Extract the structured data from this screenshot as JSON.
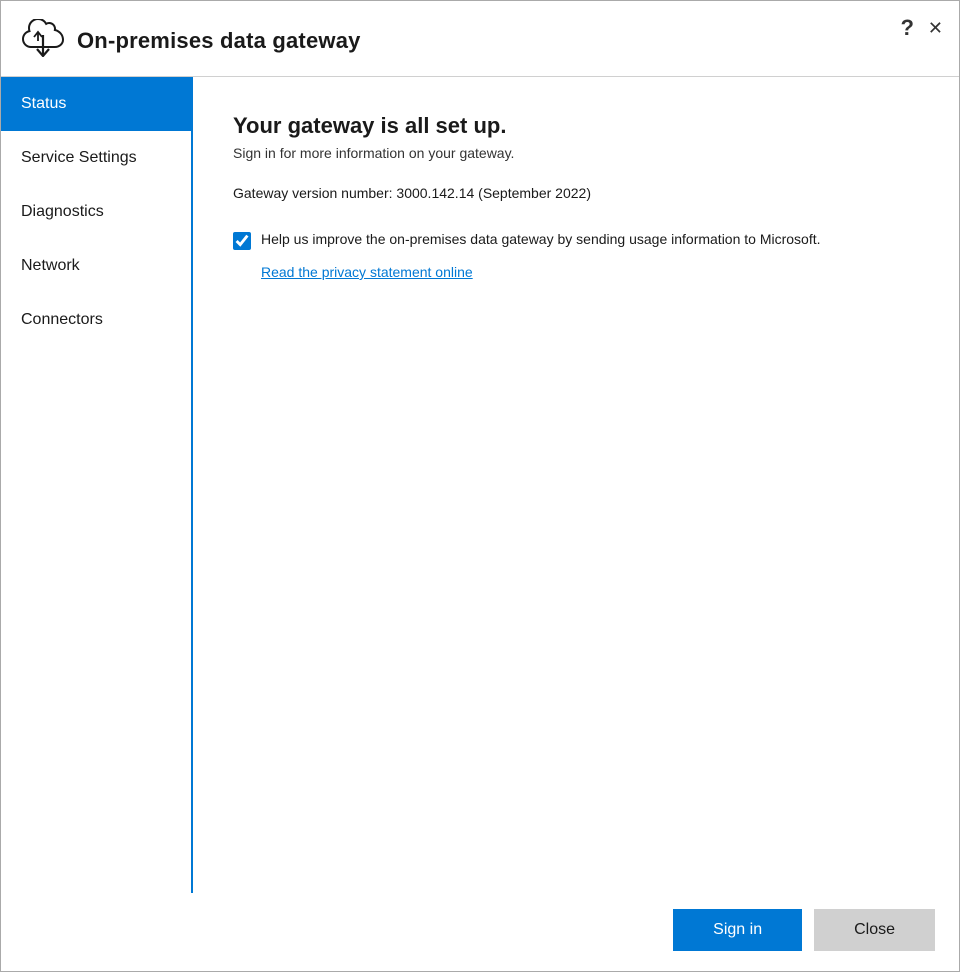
{
  "window": {
    "title": "On-premises data gateway",
    "help_icon": "?",
    "close_icon": "✕"
  },
  "sidebar": {
    "items": [
      {
        "id": "status",
        "label": "Status",
        "active": true
      },
      {
        "id": "service-settings",
        "label": "Service Settings",
        "active": false
      },
      {
        "id": "diagnostics",
        "label": "Diagnostics",
        "active": false
      },
      {
        "id": "network",
        "label": "Network",
        "active": false
      },
      {
        "id": "connectors",
        "label": "Connectors",
        "active": false
      }
    ]
  },
  "content": {
    "title": "Your gateway is all set up.",
    "subtitle": "Sign in for more information on your gateway.",
    "version_text": "Gateway version number: 3000.142.14 (September 2022)",
    "checkbox_label": "Help us improve the on-premises data gateway by sending usage information to Microsoft.",
    "privacy_link_text": "Read the privacy statement online",
    "checkbox_checked": true
  },
  "footer": {
    "signin_label": "Sign in",
    "close_label": "Close"
  }
}
